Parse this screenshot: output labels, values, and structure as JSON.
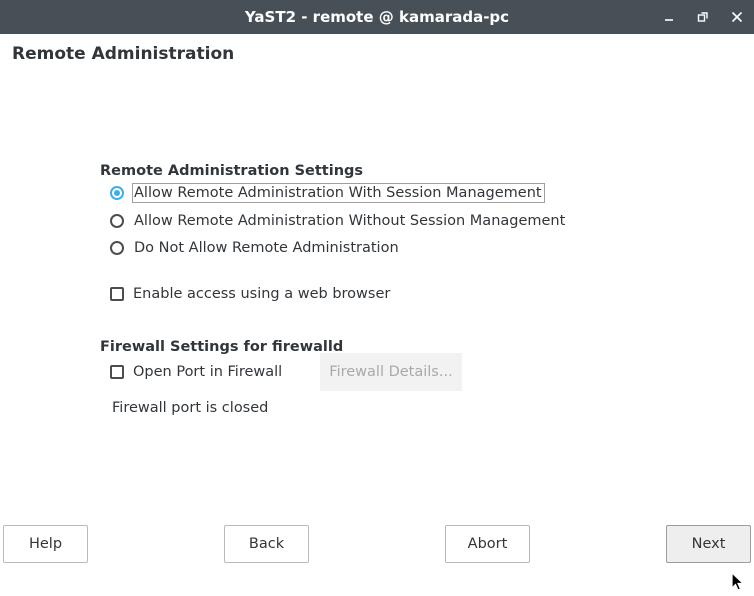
{
  "window": {
    "title": "YaST2 - remote @ kamarada-pc",
    "minimize_icon": "minimize-icon",
    "maximize_icon": "restore-icon",
    "close_icon": "close-icon"
  },
  "page": {
    "title": "Remote Administration"
  },
  "remote_admin": {
    "section_title": "Remote Administration Settings",
    "options": [
      {
        "label": "Allow Remote Administration With Session Management",
        "selected": true
      },
      {
        "label": "Allow Remote Administration Without Session Management",
        "selected": false
      },
      {
        "label": "Do Not Allow Remote Administration",
        "selected": false
      }
    ],
    "web_access_label": "Enable access using a web browser",
    "web_access_checked": false
  },
  "firewall": {
    "section_title": "Firewall Settings for firewalld",
    "open_port_label": "Open Port in Firewall",
    "open_port_checked": false,
    "details_button": "Firewall Details...",
    "status": "Firewall port is closed"
  },
  "buttons": {
    "help": "Help",
    "back": "Back",
    "abort": "Abort",
    "next": "Next"
  },
  "colors": {
    "titlebar": "#475057",
    "accent": "#3daee9",
    "text": "#31363b"
  }
}
